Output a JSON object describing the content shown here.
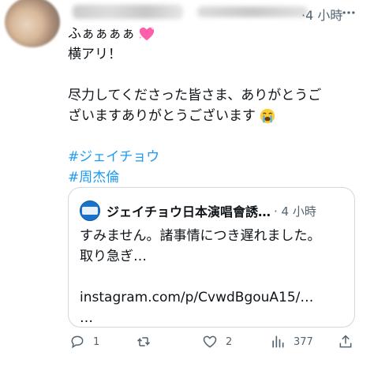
{
  "tweet": {
    "time": "·4 小時",
    "lines": [
      "ふぁぁぁぁ",
      "横アリ！"
    ],
    "lines2": [
      "尽力してくださった皆さま、ありがとうご",
      "ざいますありがとうございます"
    ],
    "hashtags": [
      "#ジェイチョウ",
      "#周杰倫"
    ]
  },
  "quote": {
    "name": "ジェイチョウ日本演唱會誘…",
    "time": "· 4 小時",
    "lines": [
      "すみません。諸事情につき遅れました。",
      "取り急ぎ…",
      "",
      "instagram.com/p/CvwdBgouA15/…",
      "…"
    ]
  },
  "actions": {
    "reply_count": "1",
    "retweet_count": "",
    "like_count": "2",
    "view_count": "377"
  },
  "colors": {
    "link": "#1d9bf0",
    "muted": "#536471",
    "border": "#cfd9de"
  }
}
